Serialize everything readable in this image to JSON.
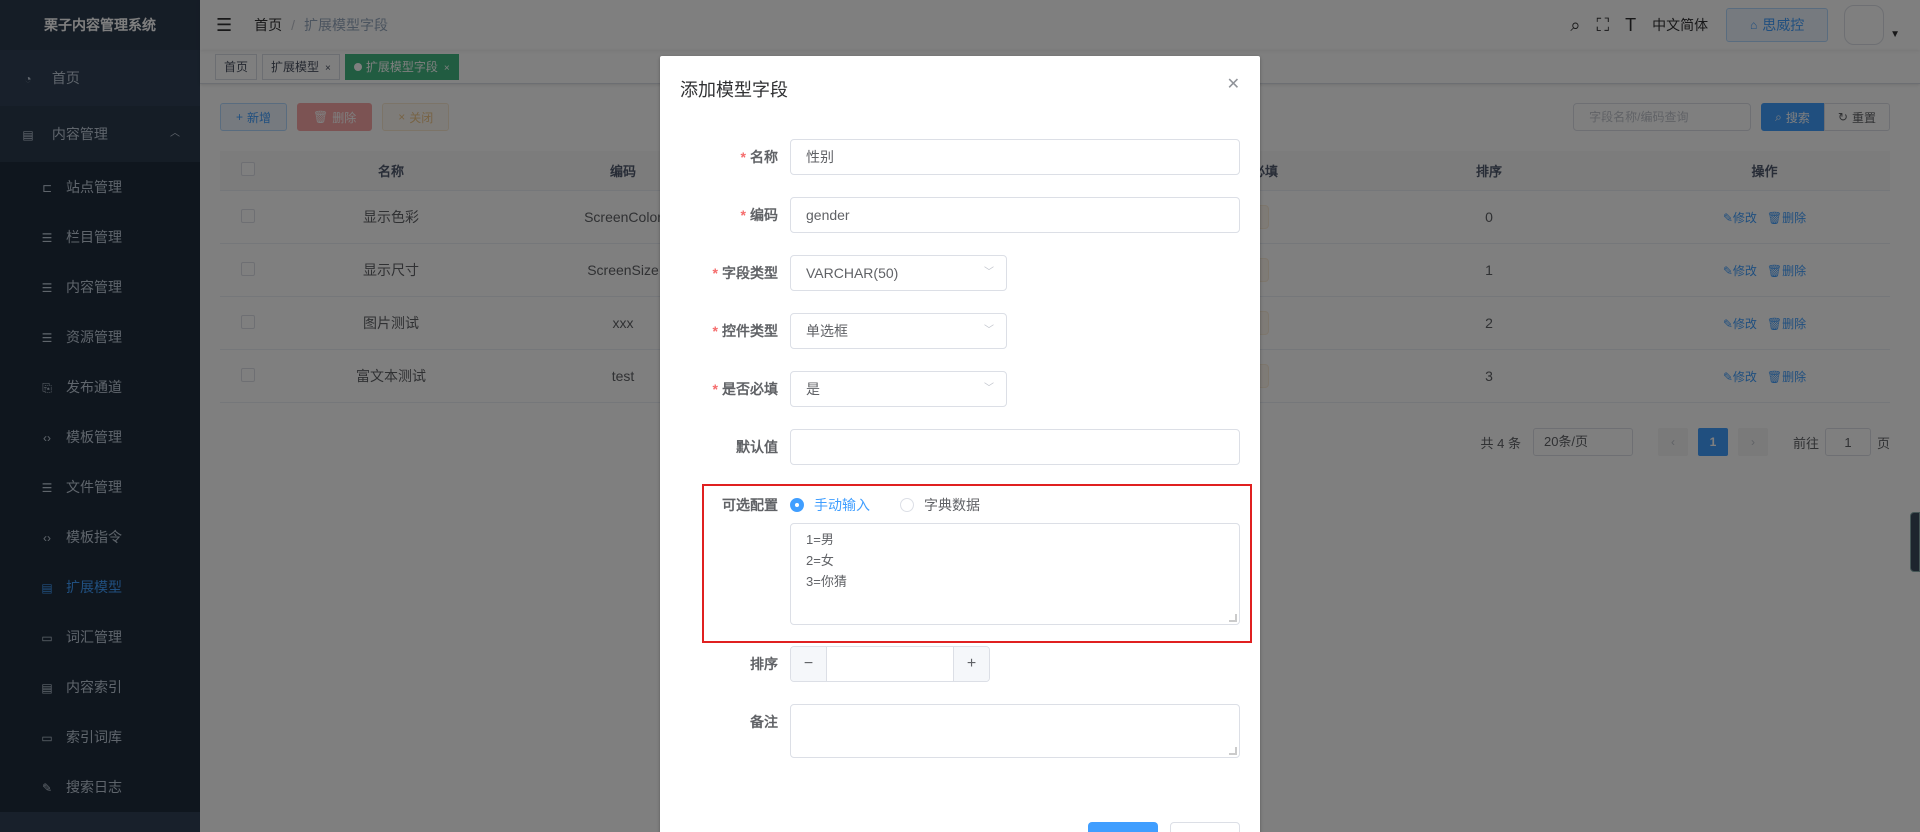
{
  "sidebar": {
    "logo": "栗子内容管理系统",
    "home": "首页",
    "group": "内容管理",
    "items": [
      {
        "label": "站点管理"
      },
      {
        "label": "栏目管理"
      },
      {
        "label": "内容管理"
      },
      {
        "label": "资源管理"
      },
      {
        "label": "发布通道"
      },
      {
        "label": "模板管理"
      },
      {
        "label": "文件管理"
      },
      {
        "label": "模板指令"
      },
      {
        "label": "扩展模型"
      },
      {
        "label": "词汇管理"
      },
      {
        "label": "内容索引"
      },
      {
        "label": "索引词库"
      },
      {
        "label": "搜索日志"
      }
    ]
  },
  "navbar": {
    "breadcrumb_home": "首页",
    "breadcrumb_current": "扩展模型字段",
    "language": "中文简体",
    "brand_button": "思威控"
  },
  "tags": [
    {
      "label": "首页"
    },
    {
      "label": "扩展模型"
    },
    {
      "label": "扩展模型字段"
    }
  ],
  "toolbar": {
    "add": "新增",
    "delete": "删除",
    "close": "关闭"
  },
  "search": {
    "placeholder": "字段名称/编码查询",
    "search_btn": "搜索",
    "reset_btn": "重置"
  },
  "table": {
    "headers": {
      "name": "名称",
      "code": "编码",
      "required": "否必填",
      "sort": "排序",
      "ops": "操作"
    },
    "rows": [
      {
        "name": "显示色彩",
        "code": "ScreenColor",
        "required": "否",
        "sort": "0"
      },
      {
        "name": "显示尺寸",
        "code": "ScreenSize",
        "required": "否",
        "sort": "1"
      },
      {
        "name": "图片测试",
        "code": "xxx",
        "required": "否",
        "sort": "2"
      },
      {
        "name": "富文本测试",
        "code": "test",
        "required": "否",
        "sort": "3"
      }
    ],
    "edit_label": "修改",
    "delete_label": "删除"
  },
  "pagination": {
    "total": "共 4 条",
    "page_size": "20条/页",
    "current": "1",
    "goto_prefix": "前往",
    "goto_value": "1",
    "goto_suffix": "页"
  },
  "dialog": {
    "title": "添加模型字段",
    "fields": {
      "name_label": "名称",
      "name_value": "性别",
      "code_label": "编码",
      "code_value": "gender",
      "field_type_label": "字段类型",
      "field_type_value": "VARCHAR(50)",
      "control_type_label": "控件类型",
      "control_type_value": "单选框",
      "required_label": "是否必填",
      "required_value": "是",
      "default_label": "默认值",
      "default_value": "",
      "options_label": "可选配置",
      "option_manual": "手动输入",
      "option_dict": "字典数据",
      "options_lines": [
        "1=男",
        "2=女",
        "3=你猜"
      ],
      "sort_label": "排序",
      "sort_value": "",
      "remark_label": "备注",
      "remark_value": ""
    }
  },
  "colors": {
    "sidebar_bg": "#304156",
    "primary": "#409eff",
    "highlight": "#e02020"
  }
}
